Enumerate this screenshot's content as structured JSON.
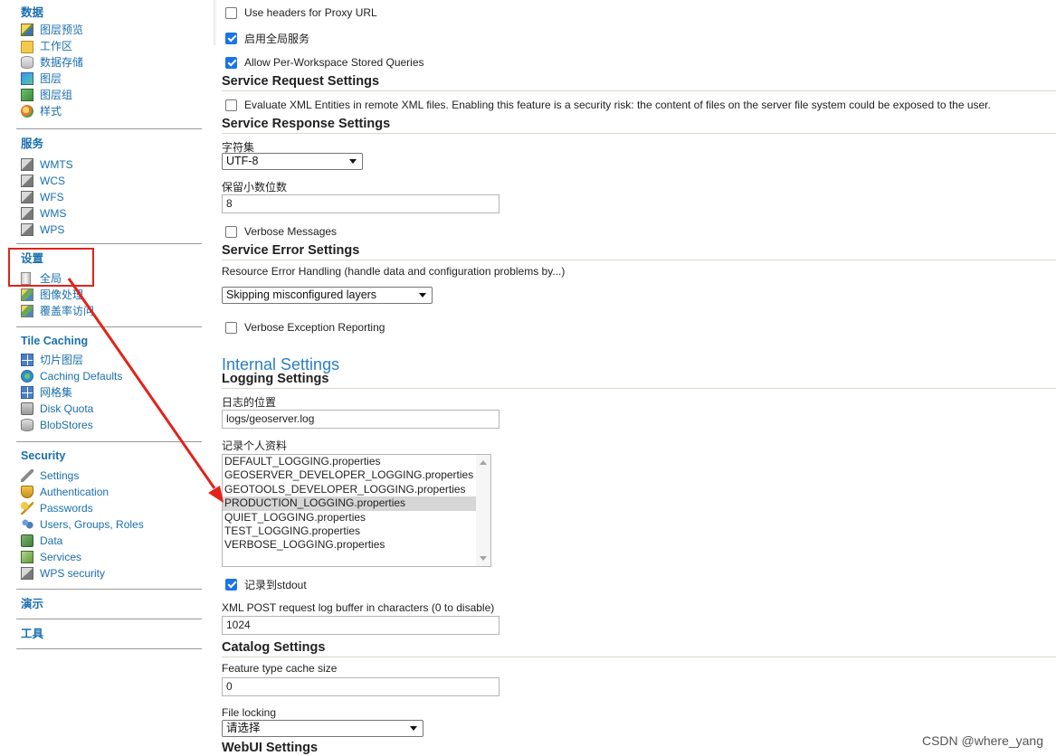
{
  "sidebar": {
    "data": {
      "title": "数据",
      "items": [
        {
          "label": "图层预览",
          "icon": "layer-preview-icon"
        },
        {
          "label": "工作区",
          "icon": "folder-icon"
        },
        {
          "label": "数据存储",
          "icon": "database-icon"
        },
        {
          "label": "图层",
          "icon": "layer-icon"
        },
        {
          "label": "图层组",
          "icon": "layer-group-icon"
        },
        {
          "label": "样式",
          "icon": "style-icon"
        }
      ]
    },
    "services": {
      "title": "服务",
      "items": [
        {
          "label": "WMTS",
          "icon": "service-icon"
        },
        {
          "label": "WCS",
          "icon": "service-icon"
        },
        {
          "label": "WFS",
          "icon": "service-icon"
        },
        {
          "label": "WMS",
          "icon": "service-icon"
        },
        {
          "label": "WPS",
          "icon": "service-icon"
        }
      ]
    },
    "settings": {
      "title": "设置",
      "items": [
        {
          "label": "全局",
          "icon": "server-icon"
        },
        {
          "label": "图像处理",
          "icon": "image-icon"
        },
        {
          "label": "覆盖率访问",
          "icon": "image-icon"
        }
      ]
    },
    "tile_caching": {
      "title": "Tile Caching",
      "items": [
        {
          "label": "切片图层",
          "icon": "grid-icon"
        },
        {
          "label": "Caching Defaults",
          "icon": "globe-icon"
        },
        {
          "label": "网格集",
          "icon": "grid-icon"
        },
        {
          "label": "Disk Quota",
          "icon": "disk-icon"
        },
        {
          "label": "BlobStores",
          "icon": "blobstore-icon"
        }
      ]
    },
    "security": {
      "title": "Security",
      "items": [
        {
          "label": "Settings",
          "icon": "wrench-icon"
        },
        {
          "label": "Authentication",
          "icon": "shield-icon"
        },
        {
          "label": "Passwords",
          "icon": "key-icon"
        },
        {
          "label": "Users, Groups, Roles",
          "icon": "users-icon"
        },
        {
          "label": "Data",
          "icon": "data-icon"
        },
        {
          "label": "Services",
          "icon": "services-security-icon"
        },
        {
          "label": "WPS security",
          "icon": "wps-icon"
        }
      ]
    },
    "demo": {
      "title": "演示"
    },
    "tools": {
      "title": "工具"
    }
  },
  "main": {
    "top_checkboxes": [
      {
        "label": "Use headers for Proxy URL",
        "checked": false
      },
      {
        "label": "启用全局服务",
        "checked": true
      },
      {
        "label": "Allow Per-Workspace Stored Queries",
        "checked": true
      }
    ],
    "service_request": {
      "heading": "Service Request Settings",
      "evaluate_xml_label": "Evaluate XML Entities in remote XML files. Enabling this feature is a security risk: the content of files on the server file system could be exposed to the user.",
      "evaluate_xml_checked": false
    },
    "service_response": {
      "heading": "Service Response Settings",
      "charset_label": "字符集",
      "charset_value": "UTF-8",
      "decimals_label": "保留小数位数",
      "decimals_value": "8",
      "verbose_label": "Verbose Messages",
      "verbose_checked": false
    },
    "service_error": {
      "heading": "Service Error Settings",
      "handling_label": "Resource Error Handling (handle data and configuration problems by...)",
      "handling_value": "Skipping misconfigured layers",
      "verbose_exception_label": "Verbose Exception Reporting",
      "verbose_exception_checked": false
    },
    "internal_heading": "Internal Settings",
    "logging": {
      "heading": "Logging Settings",
      "location_label": "日志的位置",
      "location_value": "logs/geoserver.log",
      "profile_label": "记录个人资料",
      "profiles": [
        "DEFAULT_LOGGING.properties",
        "GEOSERVER_DEVELOPER_LOGGING.properties",
        "GEOTOOLS_DEVELOPER_LOGGING.properties",
        "PRODUCTION_LOGGING.properties",
        "QUIET_LOGGING.properties",
        "TEST_LOGGING.properties",
        "VERBOSE_LOGGING.properties"
      ],
      "selected_profile": "PRODUCTION_LOGGING.properties",
      "stdout_label": "记录到stdout",
      "stdout_checked": true,
      "xml_post_label": "XML POST request log buffer in characters (0 to disable)",
      "xml_post_value": "1024"
    },
    "catalog": {
      "heading": "Catalog Settings",
      "feature_cache_label": "Feature type cache size",
      "feature_cache_value": "0",
      "file_locking_label": "File locking",
      "file_locking_value": "请选择"
    },
    "webui_heading": "WebUI Settings"
  },
  "watermark": "CSDN @where_yang",
  "colors": {
    "link": "#1a6fae",
    "highlight": "#e2231a",
    "checkbox": "#1b73e8",
    "internal_heading": "#2b7fc3"
  }
}
